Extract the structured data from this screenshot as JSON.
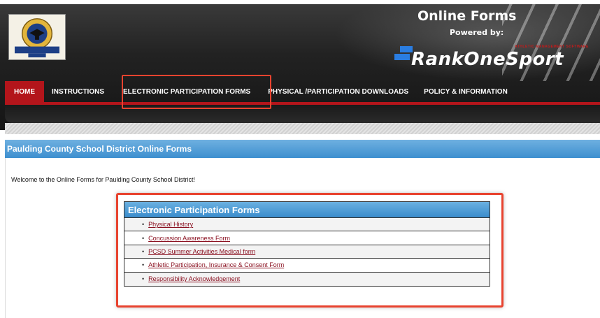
{
  "header": {
    "title": "Online Forms",
    "powered_by": "Powered by:",
    "brand_name": "RankOneSport",
    "brand_tag": "ATHLETIC MANAGEMENT SOFTWARE"
  },
  "nav": {
    "items": [
      {
        "label": "HOME"
      },
      {
        "label": "INSTRUCTIONS"
      },
      {
        "label": "ELECTRONIC PARTICIPATION FORMS"
      },
      {
        "label": "PHYSICAL /PARTICIPATION DOWNLOADS"
      },
      {
        "label": "POLICY & INFORMATION"
      }
    ]
  },
  "page": {
    "band_title": "Paulding County School District Online Forms",
    "welcome": "Welcome to the Online Forms for Paulding County School District!"
  },
  "forms": {
    "heading": "Electronic Participation Forms",
    "items": [
      {
        "label": "Physical History"
      },
      {
        "label": "Concussion Awareness Form"
      },
      {
        "label": "PCSD Summer Activities Medical form"
      },
      {
        "label": "Athletic Participation, Insurance & Consent Form"
      },
      {
        "label": "Responsibility Acknowledgement"
      }
    ]
  },
  "colors": {
    "nav_active": "#b3151b",
    "band_blue": "#3d8fcf",
    "link": "#8a1020",
    "highlight": "#e8432f"
  }
}
